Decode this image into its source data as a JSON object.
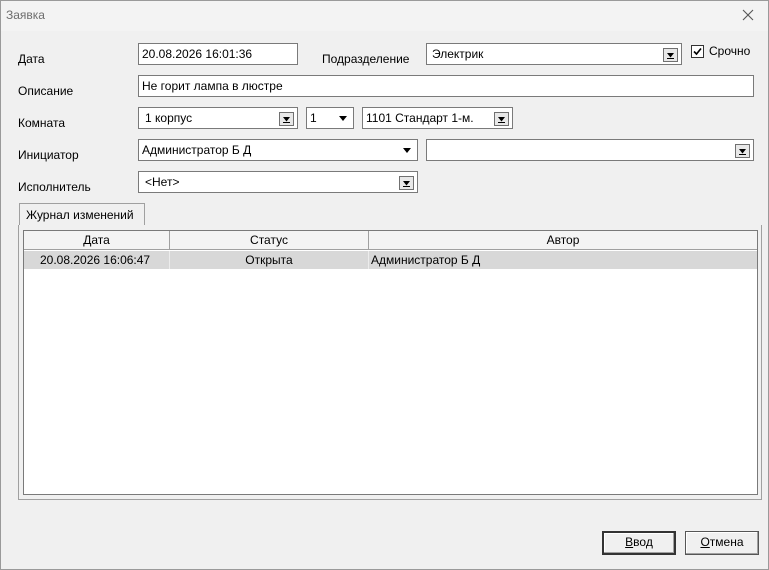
{
  "window": {
    "title": "Заявка"
  },
  "form": {
    "date_label": "Дата",
    "date_value": "20.08.2026 16:01:36",
    "division_label": "Подразделение",
    "division_value": "Электрик",
    "urgent_label": "Срочно",
    "urgent_checked": true,
    "description_label": "Описание",
    "description_value": "Не горит лампа в люстре",
    "room_label": "Комната",
    "building_value": "1 корпус",
    "floor_value": "1",
    "room_value": "1101  Стандарт 1-м.",
    "initiator_label": "Инициатор",
    "initiator_value": "Администратор Б Д",
    "initiator_extra_value": "",
    "executor_label": "Исполнитель",
    "executor_value": "<Нет>"
  },
  "tabs": [
    {
      "label": "Журнал изменений",
      "active": true
    }
  ],
  "journal": {
    "columns": [
      "Дата",
      "Статус",
      "Автор"
    ],
    "rows": [
      {
        "date": "20.08.2026 16:06:47",
        "status": "Открыта",
        "author": "Администратор Б Д"
      }
    ]
  },
  "buttons": {
    "ok_prefix": "В",
    "ok_rest": "вод",
    "cancel_prefix": "О",
    "cancel_rest": "тмена"
  }
}
